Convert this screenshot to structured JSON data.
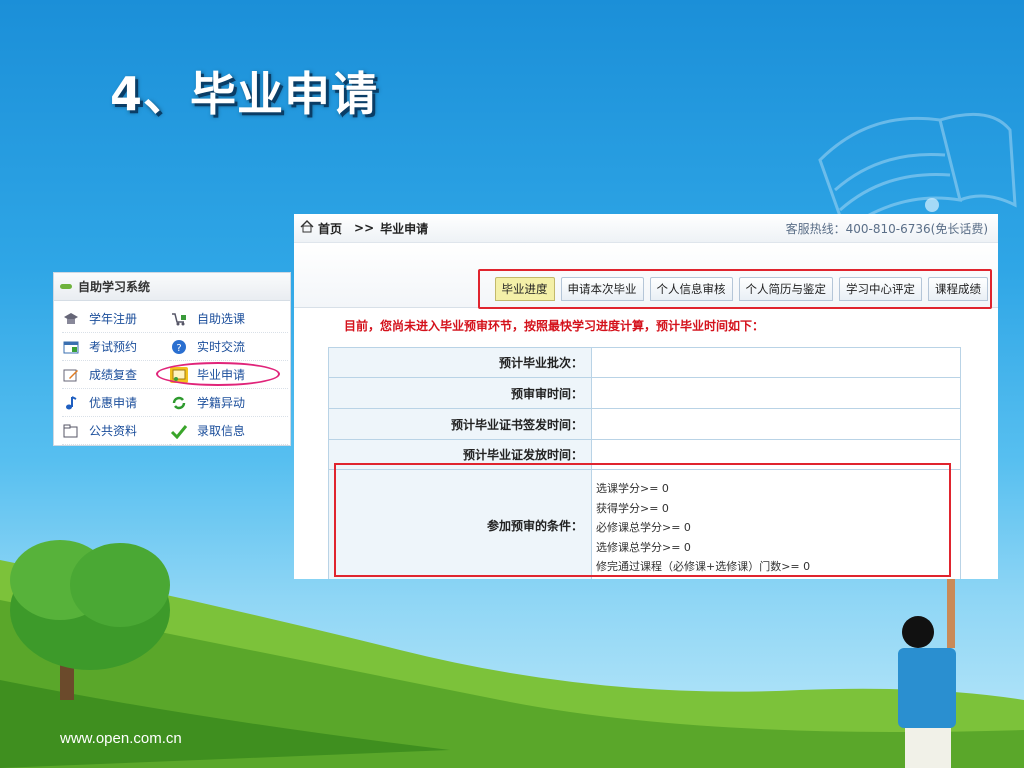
{
  "slide": {
    "title": "4、毕业申请",
    "footer": "www.open.com.cn"
  },
  "sidebar": {
    "title": "自助学习系统",
    "items": [
      {
        "label": "学年注册",
        "icon": "graduation-cap-icon"
      },
      {
        "label": "自助选课",
        "icon": "cart-icon"
      },
      {
        "label": "考试预约",
        "icon": "calendar-icon"
      },
      {
        "label": "实时交流",
        "icon": "help-icon"
      },
      {
        "label": "成绩复查",
        "icon": "edit-icon"
      },
      {
        "label": "毕业申请",
        "icon": "certificate-icon"
      },
      {
        "label": "优惠申请",
        "icon": "music-note-icon"
      },
      {
        "label": "学籍异动",
        "icon": "refresh-icon"
      },
      {
        "label": "公共资料",
        "icon": "document-icon"
      },
      {
        "label": "录取信息",
        "icon": "checkmark-icon"
      }
    ]
  },
  "main": {
    "breadcrumb": {
      "home": "首页",
      "separator": ">>",
      "current": "毕业申请"
    },
    "hotline": "客服热线：400-810-6736(免长话费)",
    "tabs": [
      "毕业进度",
      "申请本次毕业",
      "个人信息审核",
      "个人简历与鉴定",
      "学习中心评定",
      "课程成绩"
    ],
    "active_tab": 0,
    "notice": "目前，您尚未进入毕业预审环节，按照最快学习进度计算，预计毕业时间如下：",
    "rows": [
      {
        "label": "预计毕业批次："
      },
      {
        "label": "预审审时间："
      },
      {
        "label": "预计毕业证书签发时间："
      },
      {
        "label": "预计毕业证发放时间："
      }
    ],
    "conditions_label": "参加预审的条件：",
    "conditions": [
      "选课学分>= 0",
      "获得学分>= 0",
      "必修课总学分>= 0",
      "选修课总学分>= 0",
      "修完通过课程（必修课+选修课）门数>= 0"
    ]
  },
  "colors": {
    "highlight_red": "#e0242e",
    "link_blue": "#1b4e9b",
    "active_tab": "#f4f0a8"
  }
}
